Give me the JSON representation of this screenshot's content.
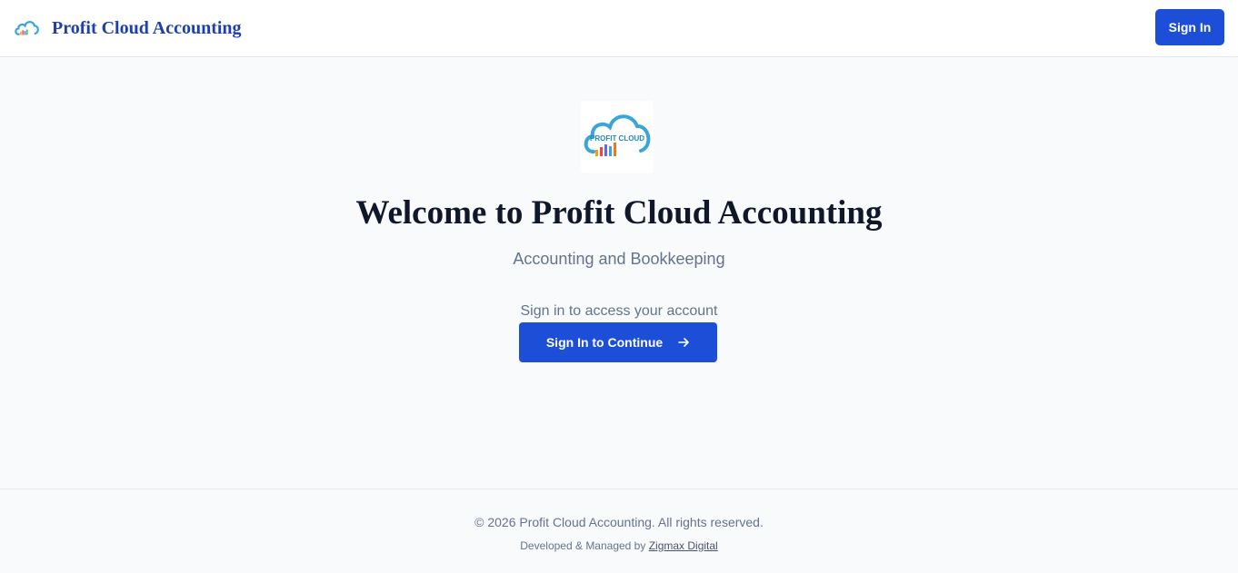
{
  "header": {
    "brand_name": "Profit Cloud Accounting",
    "logo_icon": "profit-cloud-logo",
    "signin_label": "Sign In"
  },
  "hero": {
    "logo_text": "PROFIT CLOUD",
    "title": "Welcome to Profit Cloud Accounting",
    "subtitle": "Accounting and Bookkeeping",
    "prompt": "Sign in to access your account",
    "button_label": "Sign In to Continue",
    "button_icon": "arrow-right-icon"
  },
  "footer": {
    "copyright": "© 2026 Profit Cloud Accounting. All rights reserved.",
    "credit_prefix": "Developed & Managed by ",
    "credit_link": "Zigmax Digital"
  },
  "colors": {
    "primary": "#1d4ed8",
    "brand_text": "#1e40af",
    "background": "#f8fafc",
    "muted_text": "#64748b",
    "logo_cloud": "#3aa5d8"
  }
}
